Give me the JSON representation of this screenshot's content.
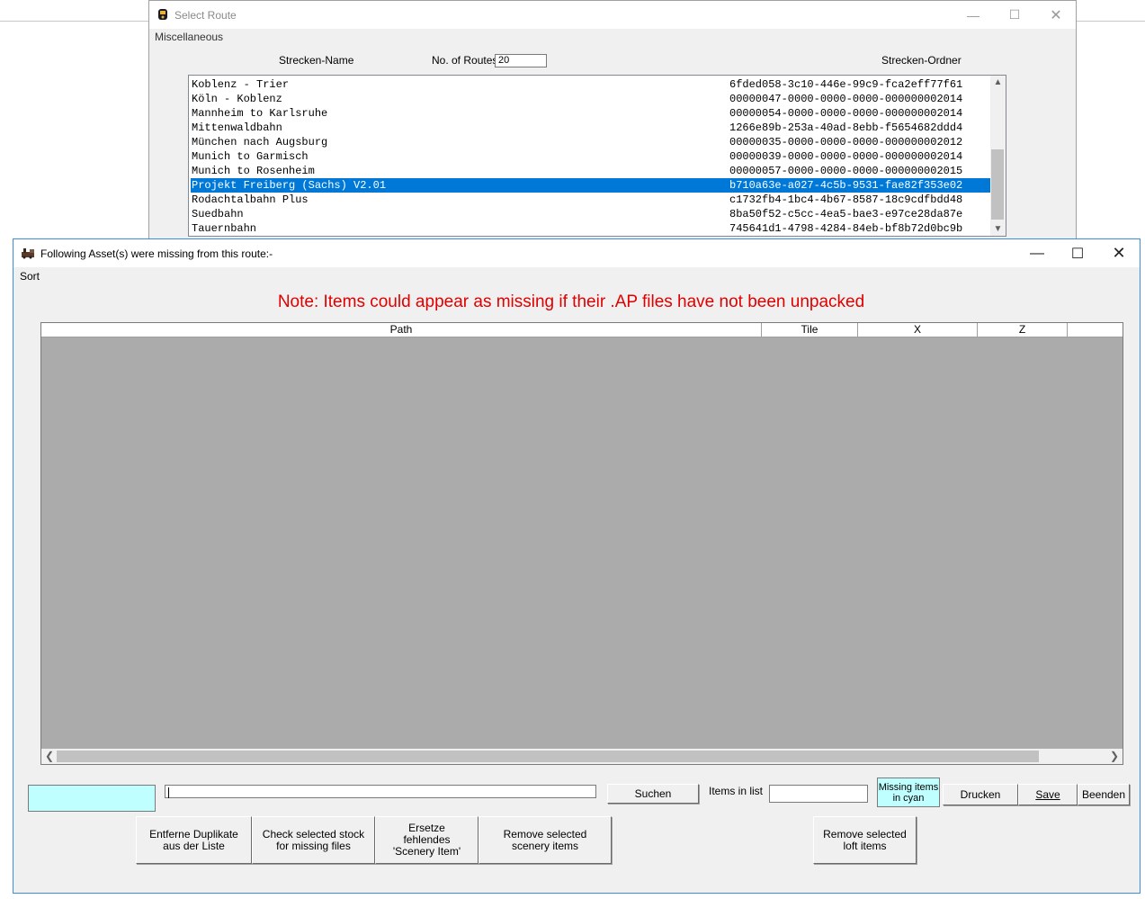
{
  "select_route_window": {
    "title": "Select Route",
    "menu": "Miscellaneous",
    "col_name_label": "Strecken-Name",
    "num_routes_label": "No. of Routes",
    "num_routes_value": "20",
    "col_folder_label": "Strecken-Ordner",
    "routes": [
      {
        "name": "Koblenz - Trier",
        "folder": "6fded058-3c10-446e-99c9-fca2eff77f61"
      },
      {
        "name": "Köln - Koblenz",
        "folder": "00000047-0000-0000-0000-000000002014"
      },
      {
        "name": "Mannheim to Karlsruhe",
        "folder": "00000054-0000-0000-0000-000000002014"
      },
      {
        "name": "Mittenwaldbahn",
        "folder": "1266e89b-253a-40ad-8ebb-f5654682ddd4"
      },
      {
        "name": "München nach Augsburg",
        "folder": "00000035-0000-0000-0000-000000002012"
      },
      {
        "name": "Munich to Garmisch",
        "folder": "00000039-0000-0000-0000-000000002014"
      },
      {
        "name": "Munich to Rosenheim",
        "folder": "00000057-0000-0000-0000-000000002015"
      },
      {
        "name": "Projekt Freiberg (Sachs) V2.01",
        "folder": "b710a63e-a027-4c5b-9531-fae82f353e02",
        "selected": true
      },
      {
        "name": "Rodachtalbahn Plus",
        "folder": "c1732fb4-1bc4-4b67-8587-18c9cdfbdd48"
      },
      {
        "name": "Suedbahn",
        "folder": "8ba50f52-c5cc-4ea5-bae3-e97ce28da87e"
      },
      {
        "name": "Tauernbahn",
        "folder": "745641d1-4798-4284-84eb-bf8b72d0bc9b"
      }
    ]
  },
  "missing_window": {
    "title": "Following Asset(s) were missing from this route:-",
    "menu": "Sort",
    "note": "Note: Items could appear as missing if their .AP files have not been unpacked",
    "columns": [
      "Path",
      "Tile",
      "X",
      "Z"
    ],
    "search_value": "",
    "search_button": "Suchen",
    "items_in_list_label": "Items in list",
    "items_in_list_value": "",
    "missing_cyan_label": "Missing items in cyan",
    "print_button": "Drucken",
    "save_button": "Save",
    "exit_button": "Beenden",
    "remove_duplicates_button": "Entferne Duplikate aus der Liste",
    "check_stock_button": "Check selected stock for missing files",
    "replace_scenery_button": "Ersetze fehlendes 'Scenery Item'",
    "remove_scenery_button": "Remove selected scenery items",
    "remove_loft_button": "Remove selected loft items",
    "highlight_color": "#c0ffff",
    "note_color": "#e00000"
  }
}
